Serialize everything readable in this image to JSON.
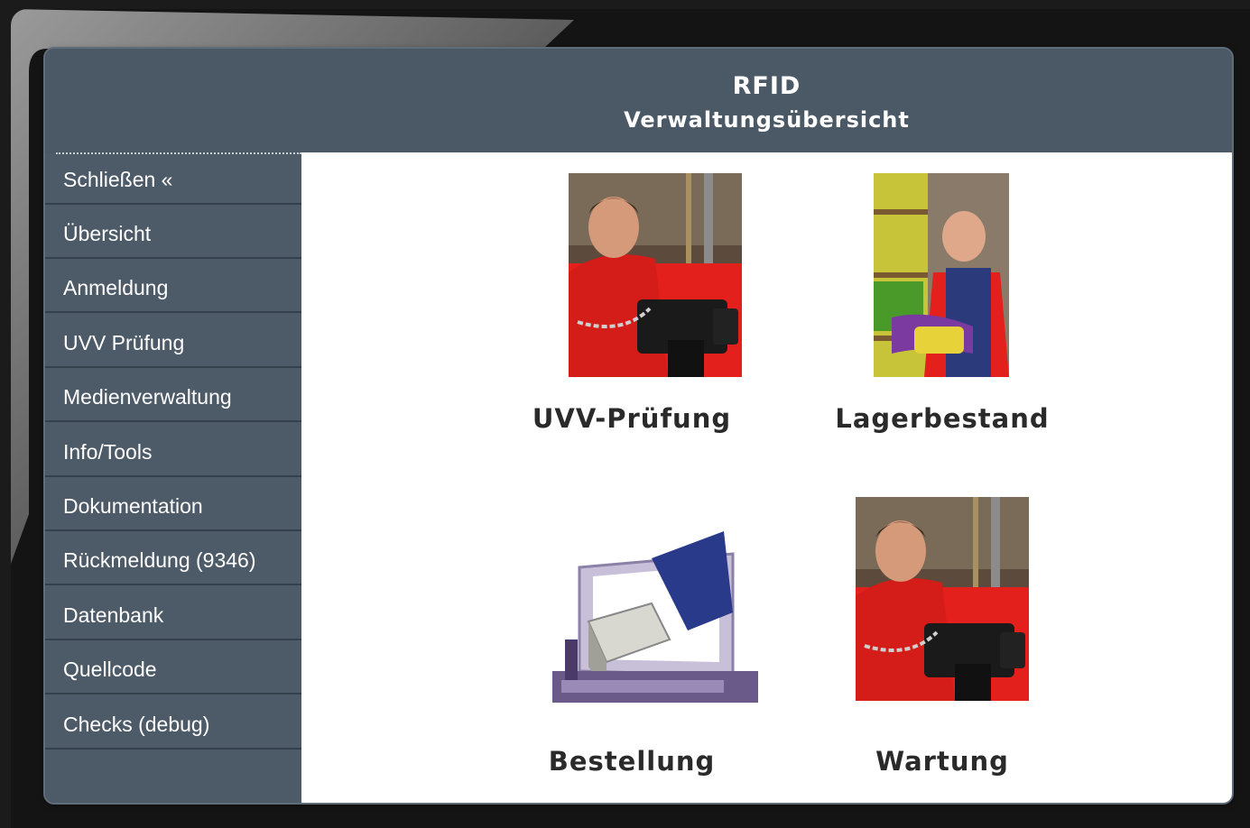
{
  "header": {
    "title": "RFID",
    "subtitle": "Verwaltungsübersicht"
  },
  "sidebar": {
    "items": [
      {
        "label": "Schließen «"
      },
      {
        "label": "Übersicht"
      },
      {
        "label": "Anmeldung"
      },
      {
        "label": "UVV Prüfung"
      },
      {
        "label": "Medienverwaltung"
      },
      {
        "label": "Info/Tools"
      },
      {
        "label": "Dokumentation"
      },
      {
        "label": "Rückmeldung (9346)"
      },
      {
        "label": "Datenbank"
      },
      {
        "label": "Quellcode"
      },
      {
        "label": "Checks (debug)"
      }
    ]
  },
  "tiles": [
    {
      "label": "UVV-Prüfung",
      "icon": "worker-chain-hoist-photo"
    },
    {
      "label": "Lagerbestand",
      "icon": "warehouse-worker-photo"
    },
    {
      "label": "Bestellung",
      "icon": "monitor-package-photo"
    },
    {
      "label": "Wartung",
      "icon": "worker-chain-hoist-photo"
    }
  ],
  "colors": {
    "panel": "#4d5b69",
    "frame": "#141414",
    "content": "#ffffff",
    "shirt_red": "#e3201b"
  }
}
